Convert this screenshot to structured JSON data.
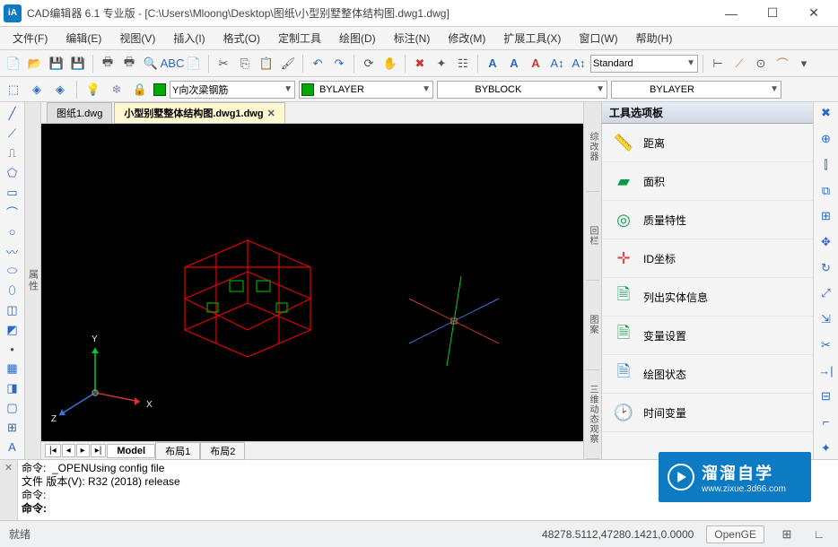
{
  "titlebar": {
    "title": "CAD编辑器 6.1 专业版  - [C:\\Users\\Mloong\\Desktop\\图纸\\小型别墅整体结构图.dwg1.dwg]"
  },
  "menu": [
    "文件(F)",
    "编辑(E)",
    "视图(V)",
    "插入(I)",
    "格式(O)",
    "定制工具",
    "绘图(D)",
    "标注(N)",
    "修改(M)",
    "扩展工具(X)",
    "窗口(W)",
    "帮助(H)"
  ],
  "prop": {
    "layer": "Y向次梁钢筋",
    "color_label": "BYLAYER",
    "lineweight_label": "BYBLOCK",
    "linetype_label": "BYLAYER"
  },
  "style": {
    "text_style": "Standard"
  },
  "tabs": [
    {
      "label": "图纸1.dwg",
      "active": false
    },
    {
      "label": "小型别墅整体结构图.dwg1.dwg",
      "active": true
    }
  ],
  "layouts": {
    "model": "Model",
    "l1": "布局1",
    "l2": "布局2"
  },
  "right_vtabs": [
    "综改器",
    "回栏",
    "图案",
    "三维动态观察"
  ],
  "panel": {
    "title": "工具选项板",
    "items": [
      {
        "label": "距离",
        "icon": "📏",
        "color": "#d48"
      },
      {
        "label": "面积",
        "icon": "▰",
        "color": "#0a9b4a"
      },
      {
        "label": "质量特性",
        "icon": "◎",
        "color": "#0a9b4a"
      },
      {
        "label": "ID坐标",
        "icon": "✛",
        "color": "#d48"
      },
      {
        "label": "列出实体信息",
        "icon": "🗎",
        "color": "#0a9b4a"
      },
      {
        "label": "变量设置",
        "icon": "🗎",
        "color": "#0a9b4a"
      },
      {
        "label": "绘图状态",
        "icon": "🗎",
        "color": "#1e7fc7"
      },
      {
        "label": "时间变量",
        "icon": "🕑",
        "color": "#666"
      }
    ]
  },
  "left_prop_label": "属性",
  "cmdline": {
    "l1": "命令:  _OPENUsing config file",
    "l2": "文件 版本(V): R32 (2018) release",
    "l3": "命令:",
    "l4": "命令:"
  },
  "status": {
    "ready": "就绪",
    "coords": "48278.5112,47280.1421,0.0000",
    "open": "OpenGE"
  },
  "watermark": {
    "main": "溜溜自学",
    "sub": "www.zixue.3d66.com"
  },
  "axis": {
    "x": "X",
    "y": "Y",
    "z": "Z"
  }
}
